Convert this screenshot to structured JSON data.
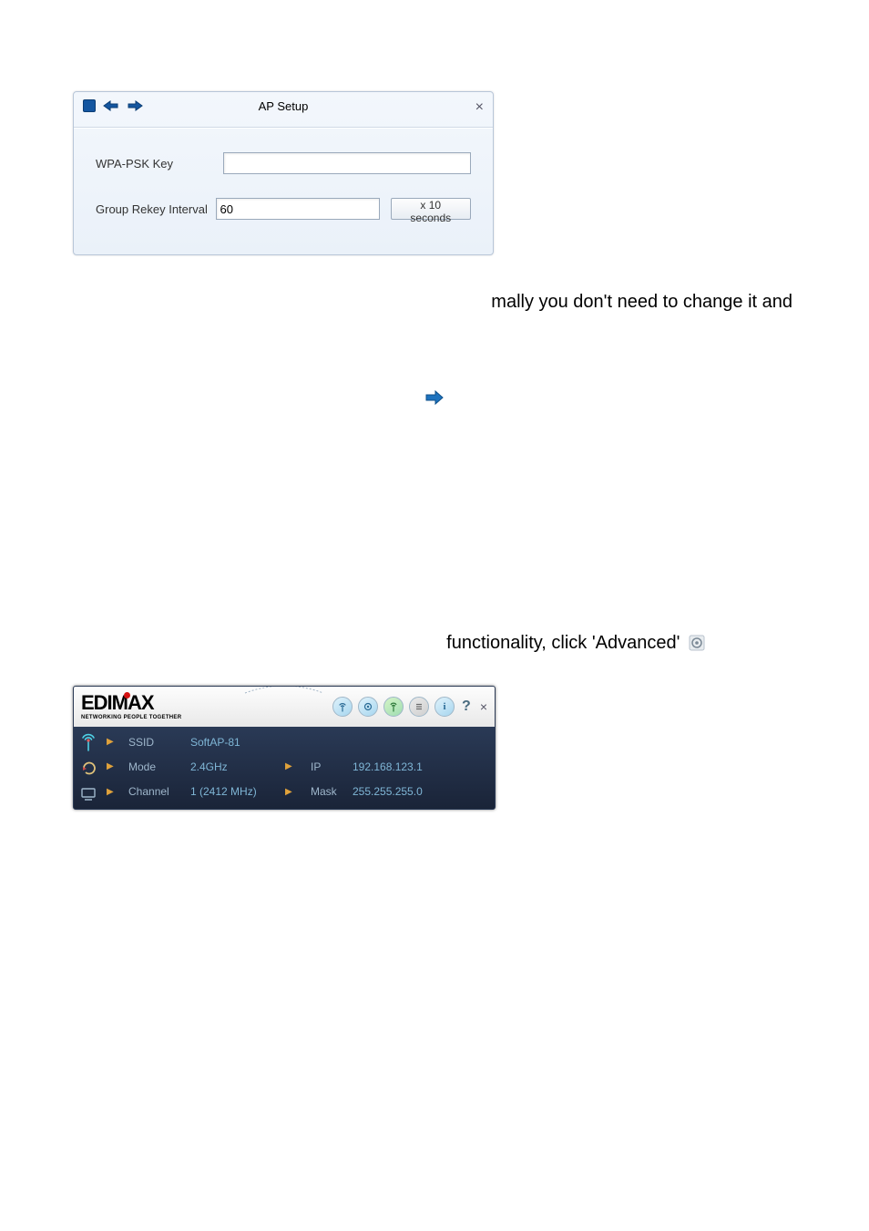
{
  "ap_setup": {
    "title": "AP Setup",
    "wpa_label": "WPA-PSK Key",
    "wpa_value": "",
    "rekey_label": "Group Rekey Interval",
    "rekey_value": "60",
    "rekey_unit": "x 10 seconds"
  },
  "text": {
    "line_normally": "mally you don't need to change it and",
    "line_advanced": "functionality, click 'Advanced'"
  },
  "edimax": {
    "brand": "EDIMAX",
    "tagline": "NETWORKING PEOPLE TOGETHER",
    "rows": {
      "ssid_label": "SSID",
      "ssid_value": "SoftAP-81",
      "mode_label": "Mode",
      "mode_value": "2.4GHz",
      "channel_label": "Channel",
      "channel_value": "1 (2412 MHz)",
      "ip_label": "IP",
      "ip_value": "192.168.123.1",
      "mask_label": "Mask",
      "mask_value": "255.255.255.0"
    },
    "icons": {
      "info_glyph": "i",
      "help_glyph": "?",
      "close_glyph": "×"
    }
  }
}
